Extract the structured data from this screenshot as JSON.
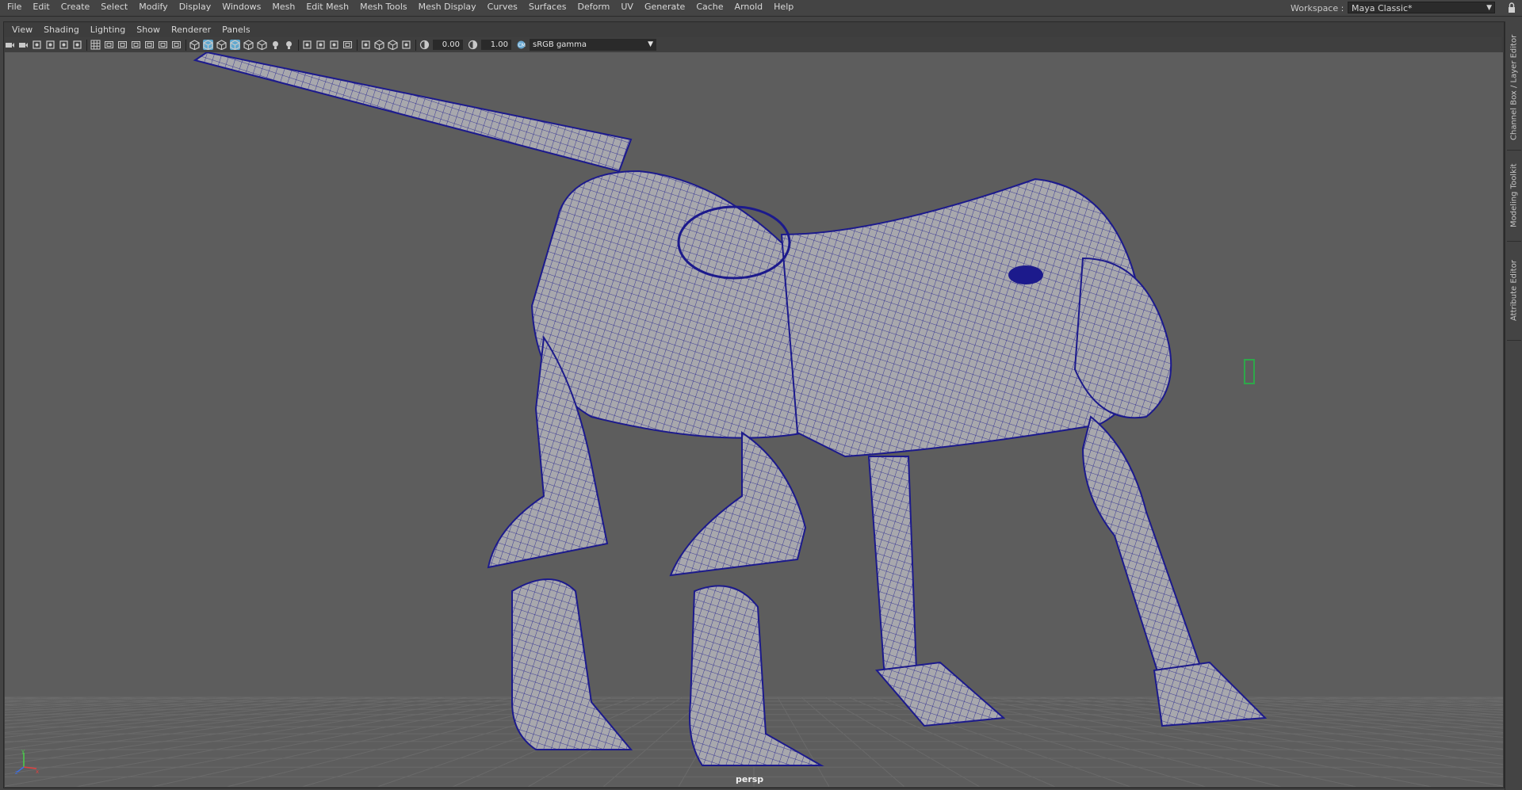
{
  "menubar": {
    "items": [
      "File",
      "Edit",
      "Create",
      "Select",
      "Modify",
      "Display",
      "Windows",
      "Mesh",
      "Edit Mesh",
      "Mesh Tools",
      "Mesh Display",
      "Curves",
      "Surfaces",
      "Deform",
      "UV",
      "Generate",
      "Cache",
      "Arnold",
      "Help"
    ],
    "workspace_label": "Workspace :",
    "workspace_value": "Maya Classic*"
  },
  "panel": {
    "menus": [
      "View",
      "Shading",
      "Lighting",
      "Show",
      "Renderer",
      "Panels"
    ],
    "toolbar": {
      "exposure_value": "0.00",
      "gamma_value": "1.00",
      "color_space": "sRGB gamma"
    },
    "camera_name": "persp"
  },
  "side_tabs": [
    "Channel Box / Layer Editor",
    "Modeling Toolkit",
    "Attribute Editor"
  ],
  "colors": {
    "background": "#444444",
    "viewport": "#5d5d5d",
    "wireframe": "#1c1a8c",
    "mesh_fill": "#a8a8ad",
    "grid": "#6a6a6a",
    "active_icon": "#5fa8cf",
    "locator": "#2ea84a"
  },
  "icons": {
    "toolbar": [
      "camera-select-icon",
      "camera-attributes-icon",
      "bookmarks-icon",
      "image-plane-icon",
      "2d-pan-zoom-icon",
      "grease-pencil-icon",
      "grid-icon",
      "film-gate-icon",
      "resolution-gate-icon",
      "gate-mask-icon",
      "field-chart-icon",
      "safe-action-icon",
      "safe-title-icon",
      "wireframe-icon",
      "smooth-shade-icon",
      "default-material-icon",
      "wireframe-on-shaded-icon",
      "xray-icon",
      "textured-icon",
      "use-lights-icon",
      "shadows-icon",
      "screen-space-ao-icon",
      "motion-blur-icon",
      "anti-aliasing-icon",
      "depth-of-field-icon",
      "isolate-select-icon",
      "xray-active-icon",
      "xray-joints-icon",
      "backface-culling-icon",
      "exposure-icon",
      "gamma-icon",
      "color-management-icon"
    ]
  }
}
